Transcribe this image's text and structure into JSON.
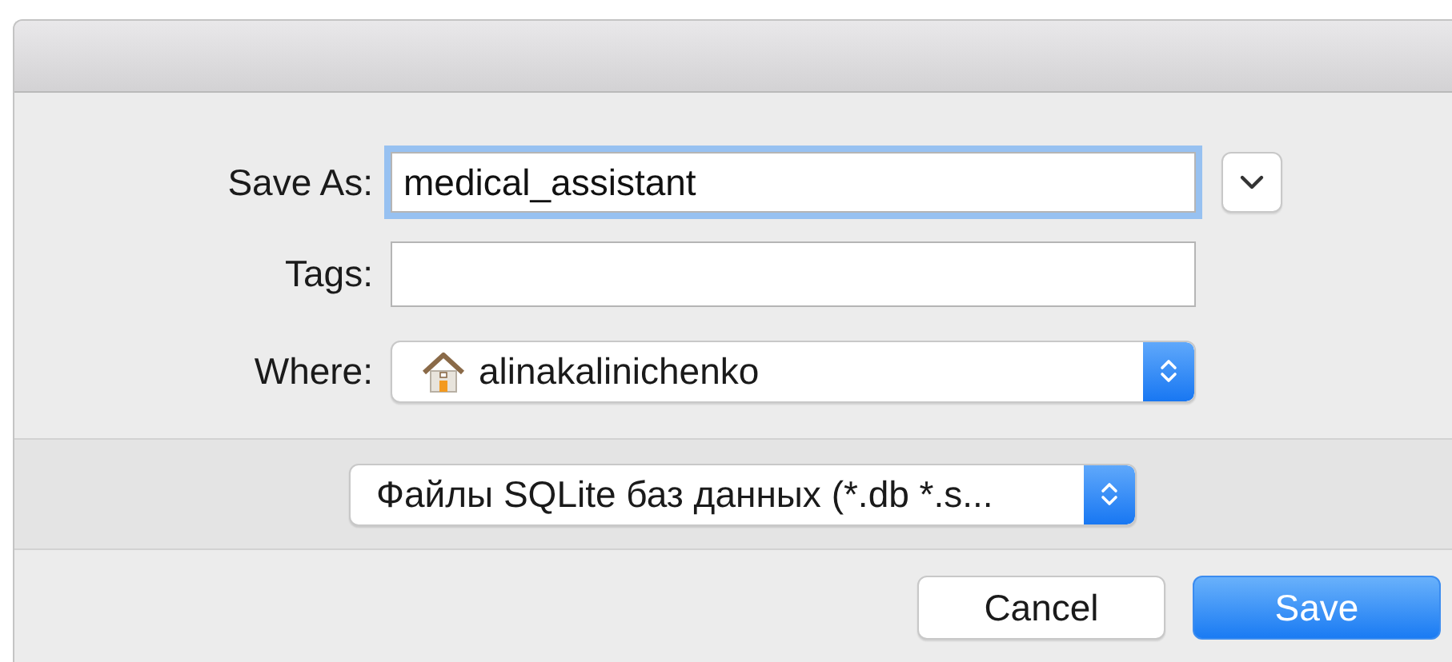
{
  "save_as": {
    "label": "Save As:",
    "value": "medical_assistant",
    "focused": true
  },
  "expand_button": {
    "expanded": false
  },
  "tags": {
    "label": "Tags:"
  },
  "where": {
    "label": "Where:",
    "value": "alinakalinichenko"
  },
  "file_format": {
    "value": "Файлы SQLite баз данных (*.db *.s..."
  },
  "buttons": [
    {
      "label": "Cancel",
      "default": false
    },
    {
      "label": "Save",
      "default": true
    }
  ]
}
